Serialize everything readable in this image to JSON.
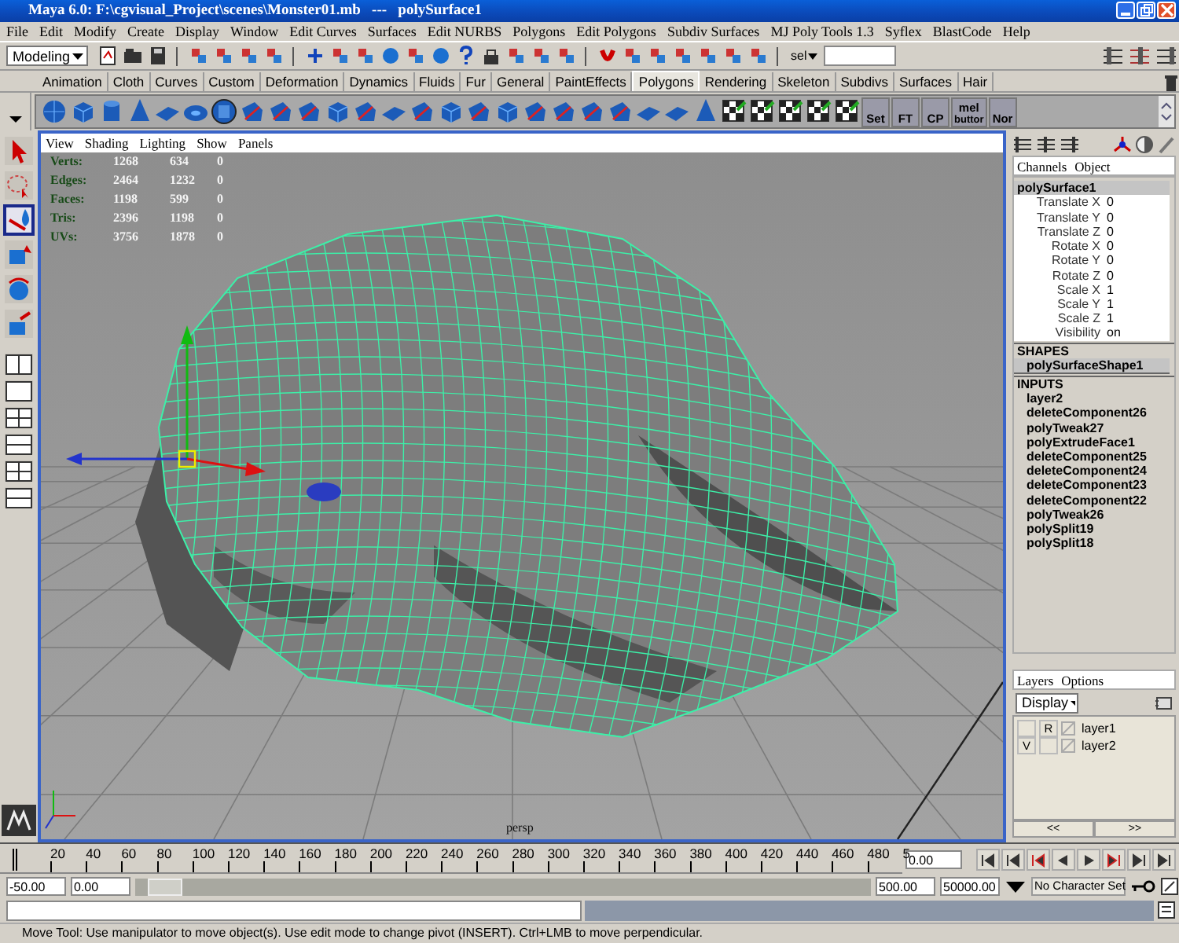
{
  "window": {
    "title": "Maya 6.0: F:\\cgvisual_Project\\scenes\\Monster01.mb   ---   polySurface1"
  },
  "menu_bar": [
    "File",
    "Edit",
    "Modify",
    "Create",
    "Display",
    "Window",
    "Edit Curves",
    "Surfaces",
    "Edit NURBS",
    "Polygons",
    "Edit Polygons",
    "Subdiv Surfaces",
    "MJ Poly Tools 1.3",
    "Syflex",
    "BlastCode",
    "Help"
  ],
  "status_line": {
    "mode": "Modeling",
    "selection_label": "sel"
  },
  "shelf": {
    "tabs": [
      {
        "label": "Animation",
        "selected": false
      },
      {
        "label": "Cloth",
        "selected": false
      },
      {
        "label": "Curves",
        "selected": false
      },
      {
        "label": "Custom",
        "selected": false
      },
      {
        "label": "Deformation",
        "selected": false
      },
      {
        "label": "Dynamics",
        "selected": false
      },
      {
        "label": "Fluids",
        "selected": false
      },
      {
        "label": "Fur",
        "selected": false
      },
      {
        "label": "General",
        "selected": false
      },
      {
        "label": "PaintEffects",
        "selected": false
      },
      {
        "label": "Polygons",
        "selected": true
      },
      {
        "label": "Rendering",
        "selected": false
      },
      {
        "label": "Skeleton",
        "selected": false
      },
      {
        "label": "Subdivs",
        "selected": false
      },
      {
        "label": "Surfaces",
        "selected": false
      },
      {
        "label": "Hair",
        "selected": false
      }
    ],
    "buttons": [
      {
        "label": "Set"
      },
      {
        "label": "FT"
      },
      {
        "label": "CP"
      },
      {
        "label": "mel",
        "sublabel": "buttor"
      },
      {
        "label": "Nor"
      }
    ]
  },
  "toolbox": [
    {
      "kind": "select",
      "selected": false
    },
    {
      "kind": "lasso",
      "selected": false
    },
    {
      "kind": "paint",
      "selected": true
    },
    {
      "kind": "move",
      "selected": false
    },
    {
      "kind": "rotate",
      "selected": false
    },
    {
      "kind": "scale",
      "selected": false
    }
  ],
  "viewport": {
    "menus": [
      "View",
      "Shading",
      "Lighting",
      "Show",
      "Panels"
    ],
    "stats": [
      {
        "label": "Verts:",
        "values": [
          "1268",
          "634",
          "0"
        ]
      },
      {
        "label": "Edges:",
        "values": [
          "2464",
          "1232",
          "0"
        ]
      },
      {
        "label": "Faces:",
        "values": [
          "1198",
          "599",
          "0"
        ]
      },
      {
        "label": "Tris:",
        "values": [
          "2396",
          "1198",
          "0"
        ]
      },
      {
        "label": "UVs:",
        "values": [
          "3756",
          "1878",
          "0"
        ]
      }
    ],
    "camera": "persp"
  },
  "channel_box": {
    "tabs": [
      "Channels",
      "Object"
    ],
    "node": "polySurface1",
    "channels": [
      {
        "name": "Translate X",
        "value": "0"
      },
      {
        "name": "Translate Y",
        "value": "0"
      },
      {
        "name": "Translate Z",
        "value": "0"
      },
      {
        "name": "Rotate X",
        "value": "0"
      },
      {
        "name": "Rotate Y",
        "value": "0"
      },
      {
        "name": "Rotate Z",
        "value": "0"
      },
      {
        "name": "Scale X",
        "value": "1"
      },
      {
        "name": "Scale Y",
        "value": "1"
      },
      {
        "name": "Scale Z",
        "value": "1"
      },
      {
        "name": "Visibility",
        "value": "on"
      }
    ],
    "shapes_heading": "SHAPES",
    "shape": "polySurfaceShape1",
    "inputs_heading": "INPUTS",
    "inputs": [
      "layer2",
      "deleteComponent26",
      "polyTweak27",
      "polyExtrudeFace1",
      "deleteComponent25",
      "deleteComponent24",
      "deleteComponent23",
      "deleteComponent22",
      "polyTweak26",
      "polySplit19",
      "polySplit18"
    ]
  },
  "layer_editor": {
    "menus": [
      "Layers",
      "Options"
    ],
    "mode": "Display",
    "layers": [
      {
        "reference": "R",
        "name": "layer1"
      },
      {
        "visibility": "V",
        "name": "layer2"
      }
    ],
    "buttons": [
      "<<",
      ">>"
    ]
  },
  "time_slider": {
    "ticks": [
      "20",
      "40",
      "60",
      "80",
      "100",
      "120",
      "140",
      "160",
      "180",
      "200",
      "220",
      "240",
      "260",
      "280",
      "300",
      "320",
      "340",
      "360",
      "380",
      "400",
      "420",
      "440",
      "460",
      "480",
      "5"
    ],
    "level": 0,
    "current_time": "0.00"
  },
  "range_slider": {
    "level": 0.01,
    "start": "-50.00",
    "range_start": "0.00",
    "range_end": "500.00",
    "end": "50000.00",
    "character_set": "No Character Set"
  },
  "help_line": "Move Tool: Use manipulator to move object(s). Use edit mode to change pivot (INSERT).  Ctrl+LMB to move perpendicular."
}
